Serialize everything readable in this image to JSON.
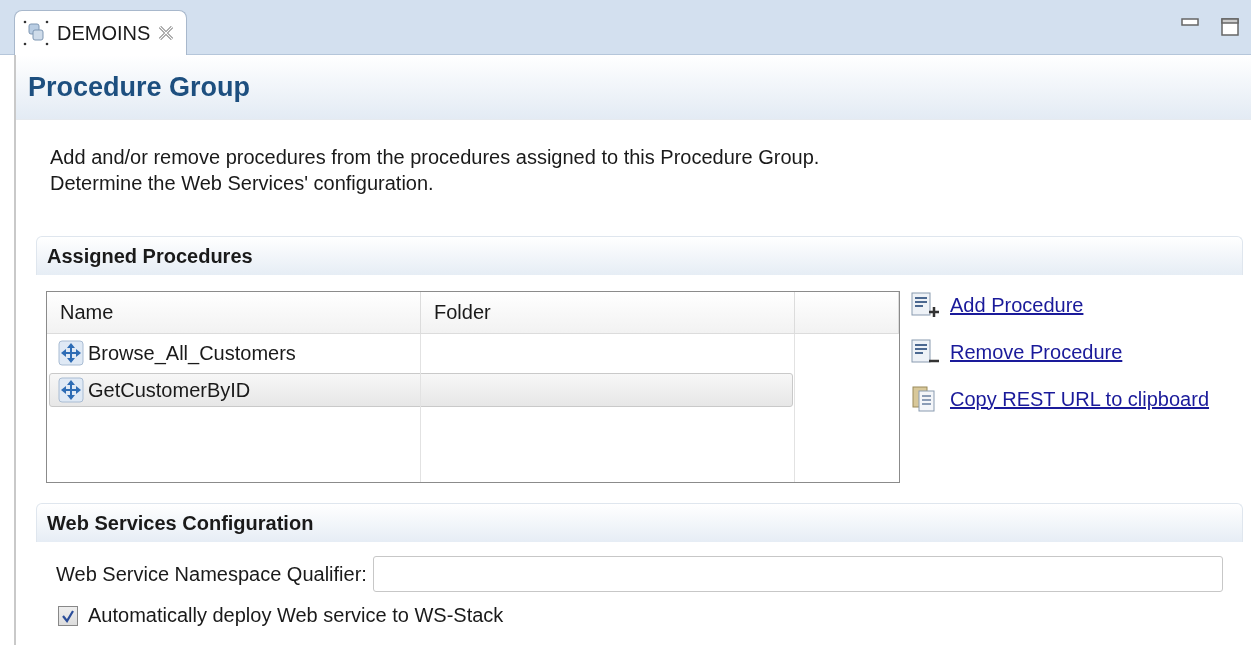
{
  "editor_tab": {
    "label": "DEMOINS",
    "selected": true
  },
  "header": {
    "title": "Procedure Group"
  },
  "description": "Add and/or remove procedures from the procedures assigned to this Procedure Group. Determine the Web Services' configuration.",
  "assigned_procedures": {
    "title": "Assigned Procedures",
    "table": {
      "columns": [
        "Name",
        "Folder"
      ],
      "rows": [
        {
          "name": "Browse_All_Customers",
          "selected": false
        },
        {
          "name": "GetCustomerByID",
          "selected": true
        }
      ]
    },
    "actions": [
      {
        "kind": "add",
        "label": "Add Procedure"
      },
      {
        "kind": "remove",
        "label": "Remove Procedure"
      },
      {
        "kind": "copy",
        "label": "Copy REST URL to clipboard"
      }
    ]
  },
  "web_services_configuration": {
    "title": "Web Services Configuration",
    "namespace_label": "Web Service Namespace Qualifier:",
    "auto_deploy": {
      "label": "Automatically deploy Web service to WS-Stack",
      "checked": true
    }
  }
}
